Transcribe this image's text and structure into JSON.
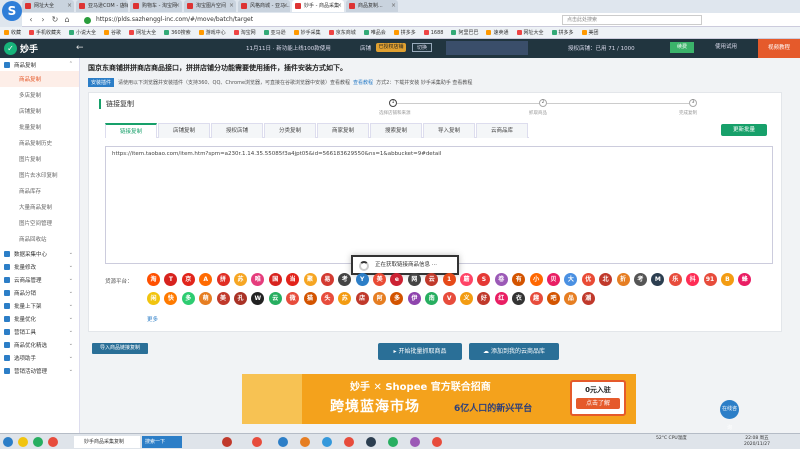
{
  "browser": {
    "tabs": [
      {
        "label": "网址大全",
        "active": false
      },
      {
        "label": "亚马逊COM - 店铺...",
        "active": false
      },
      {
        "label": "购物车 - 淘宝网",
        "active": false
      },
      {
        "label": "淘宝图片空间",
        "active": false
      },
      {
        "label": "风格商城 - 亚马...",
        "active": false
      },
      {
        "label": "妙手 - 商品采集",
        "active": true
      },
      {
        "label": "商品复制...",
        "active": false
      }
    ],
    "url": "https://plds.sazhenggl-inc.com/#/move/batch/target",
    "search_placeholder": "点击此处搜索",
    "bookmarks": [
      "收藏",
      "手机收藏夹",
      "小说大全",
      "谷歌",
      "网址大全",
      "360搜索",
      "游戏中心",
      "淘宝网",
      "亚马逊",
      "妙手采集",
      "京东商城",
      "唯品会",
      "拼多多",
      "1688",
      "阿里巴巴",
      "速卖通",
      "网址大全",
      "拼多多",
      "美团"
    ]
  },
  "app_header": {
    "logo": "妙手",
    "collapse_icon": "←",
    "notice": "11月11日 · 新功能上线100款使用",
    "shop_label": "店铺",
    "shop_badge": "已授权店铺",
    "shop_name": "切换",
    "vip_text": "授权店铺：已用 71 / 1000",
    "renew": "续费",
    "trial": "使用试用",
    "course": "视频教程"
  },
  "sidebar": {
    "groups": [
      {
        "label": "商品复制",
        "items": [
          "商品复制",
          "多店复制",
          "店铺复制",
          "批量复制",
          "商品复制历史",
          "图片复制",
          "图片去水印复制",
          "商品库存",
          "大量商品复制",
          "图片空间管理",
          "商品回收站"
        ]
      },
      {
        "label": "数据采集中心",
        "items": []
      },
      {
        "label": "批量修改",
        "items": []
      },
      {
        "label": "云商品管理",
        "items": []
      },
      {
        "label": "商品分销",
        "items": []
      },
      {
        "label": "批量上下架",
        "items": []
      },
      {
        "label": "批量优化",
        "items": []
      },
      {
        "label": "营销工具",
        "items": []
      },
      {
        "label": "商品优化精选",
        "items": []
      },
      {
        "label": "选项助手",
        "items": []
      },
      {
        "label": "营销活动管理",
        "items": []
      }
    ],
    "active_item": "商品复制"
  },
  "main": {
    "banner": "国京东商铺拼拼商店商品接口，拼拼店铺分功能需要使用插件，插件安装方式如下。",
    "hint_badge": "安装插件",
    "hint_text": "请使用以下浏览器并安装插件（支持360、QQ、Chrome浏览器，可直接在谷歌浏览器中安装）查看教程",
    "hint_link": "查看教程",
    "hint_tail": "方式2：下载并安装 妙手采集助手 查看教程",
    "card_title": "链接复制",
    "steps": [
      {
        "label": "选择店铺和来源",
        "num": "1"
      },
      {
        "label": "抓取商品",
        "num": "2"
      },
      {
        "label": "完成复制",
        "num": "3"
      }
    ],
    "tabs": [
      "链接复制",
      "店铺复制",
      "授权店铺",
      "分类复制",
      "商家复制",
      "搜索复制",
      "导入复制",
      "云商品库"
    ],
    "active_tab": "链接复制",
    "tool_button": "更新批量",
    "url_value": "https://item.taobao.com/item.htm?spm=a230r.1.14.35.55085f3a4jpt05&id=566183629550&ns=1&abbucket=9#detail",
    "loading_text": "正在获取链接商品信息 ···",
    "platform_label": "货源平台：",
    "platforms": [
      {
        "t": "淘",
        "c": "#ff5000"
      },
      {
        "t": "T",
        "c": "#d7231e"
      },
      {
        "t": "京",
        "c": "#e1251b"
      },
      {
        "t": "A",
        "c": "#ff6a00"
      },
      {
        "t": "拼",
        "c": "#e02e24"
      },
      {
        "t": "苏",
        "c": "#f6a623"
      },
      {
        "t": "唯",
        "c": "#e53d7c"
      },
      {
        "t": "国",
        "c": "#d7231e"
      },
      {
        "t": "当",
        "c": "#e2231a"
      },
      {
        "t": "聚",
        "c": "#f6a623"
      },
      {
        "t": "易",
        "c": "#d33a31"
      },
      {
        "t": "考",
        "c": "#444444"
      },
      {
        "t": "Y",
        "c": "#2c7ec7"
      },
      {
        "t": "美",
        "c": "#e94b35"
      },
      {
        "t": "e",
        "c": "#cc2233"
      },
      {
        "t": "网",
        "c": "#444444"
      },
      {
        "t": "云",
        "c": "#c0392b"
      },
      {
        "t": "1",
        "c": "#e64a19"
      },
      {
        "t": "蘑",
        "c": "#ff4466"
      },
      {
        "t": "S",
        "c": "#e53935"
      },
      {
        "t": "卷",
        "c": "#9b59b6"
      },
      {
        "t": "有",
        "c": "#d35400"
      },
      {
        "t": "小",
        "c": "#ff6700"
      },
      {
        "t": "贝",
        "c": "#e91e63"
      },
      {
        "t": "大",
        "c": "#4a90e2"
      },
      {
        "t": "优",
        "c": "#e94b35"
      },
      {
        "t": "北",
        "c": "#c0392b"
      },
      {
        "t": "折",
        "c": "#e67e22"
      },
      {
        "t": "考",
        "c": "#555555"
      },
      {
        "t": "M",
        "c": "#2c3e50"
      },
      {
        "t": "乐",
        "c": "#e74c3c"
      },
      {
        "t": "抖",
        "c": "#ff2d55"
      },
      {
        "t": "91",
        "c": "#e74c3c"
      },
      {
        "t": "B",
        "c": "#f39c12"
      },
      {
        "t": "蜂",
        "c": "#e91e63"
      },
      {
        "t": "闲",
        "c": "#f1c40f"
      },
      {
        "t": "快",
        "c": "#ff7a00"
      },
      {
        "t": "多",
        "c": "#2ecc71"
      },
      {
        "t": "萌",
        "c": "#e67e22"
      },
      {
        "t": "美",
        "c": "#c0392b"
      },
      {
        "t": "孔",
        "c": "#a93226"
      },
      {
        "t": "W",
        "c": "#222222"
      },
      {
        "t": "云",
        "c": "#27ae60"
      },
      {
        "t": "微",
        "c": "#e74c3c"
      },
      {
        "t": "猫",
        "c": "#d35400"
      },
      {
        "t": "头",
        "c": "#e74c3c"
      },
      {
        "t": "苏",
        "c": "#f39c12"
      },
      {
        "t": "店",
        "c": "#c0392b"
      },
      {
        "t": "阿",
        "c": "#e67e22"
      },
      {
        "t": "多",
        "c": "#d35400"
      },
      {
        "t": "伊",
        "c": "#8e44ad"
      },
      {
        "t": "南",
        "c": "#27ae60"
      },
      {
        "t": "V",
        "c": "#e74c3c"
      },
      {
        "t": "义",
        "c": "#f39c12"
      },
      {
        "t": "好",
        "c": "#c0392b"
      },
      {
        "t": "红",
        "c": "#e91e63"
      },
      {
        "t": "衣",
        "c": "#333333"
      },
      {
        "t": "趣",
        "c": "#e74c3c"
      },
      {
        "t": "吧",
        "c": "#d35400"
      },
      {
        "t": "品",
        "c": "#e67e22"
      },
      {
        "t": "潮",
        "c": "#c0392b"
      }
    ],
    "more": "更多",
    "import_button": "导入商品链接复制",
    "start_button": "开始批量抓取商品",
    "add_button": "添加到我的云商品库",
    "ad": {
      "brand": "妙手 ✕ Shopee 官方联合招商",
      "title": "跨境蓝海市场",
      "subtitle": "6亿人口的新兴平台",
      "cta_top": "0元入驻",
      "cta_button": "点击了解"
    },
    "float_button": "在线咨询"
  },
  "taskbar": {
    "task_item": "妙手商品采集复制",
    "search": "搜索一下",
    "weather": "52°C  CPU温度",
    "time": "22:08 周五",
    "date": "2020/11/27"
  }
}
